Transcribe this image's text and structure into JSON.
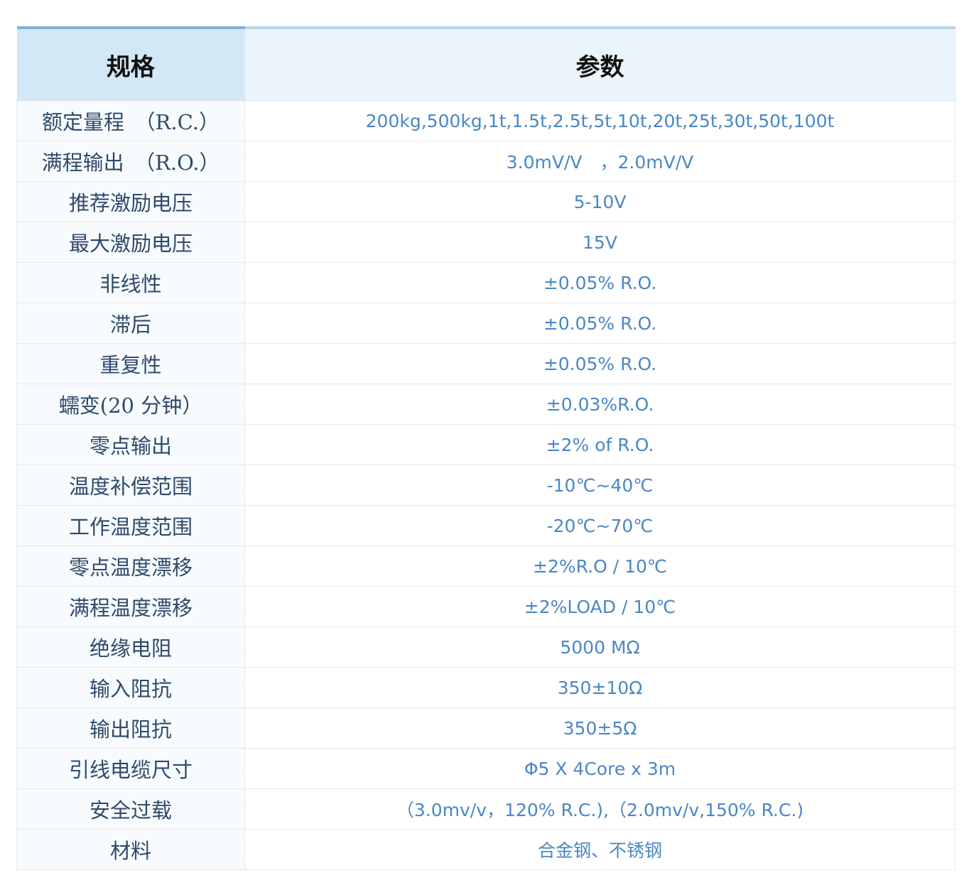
{
  "table": {
    "headers": [
      "规格",
      "参数"
    ],
    "rows": [
      {
        "spec": "额定量程　（R.C.）",
        "value": "200kg,500kg,1t,1.5t,2.5t,5t,10t,20t,25t,30t,50t,100t"
      },
      {
        "spec": "满程输出　（R.O.）",
        "value": "3.0mV/V　，2.0mV/V"
      },
      {
        "spec": "推荐激励电压",
        "value": "5-10V"
      },
      {
        "spec": "最大激励电压",
        "value": "15V"
      },
      {
        "spec": "非线性",
        "value": "±0.05% R.O."
      },
      {
        "spec": "滞后",
        "value": "±0.05% R.O."
      },
      {
        "spec": "重复性",
        "value": "±0.05% R.O."
      },
      {
        "spec": "蠕变(20 分钟）",
        "value": "±0.03%R.O."
      },
      {
        "spec": "零点输出",
        "value": "±2% of R.O."
      },
      {
        "spec": "温度补偿范围",
        "value": "-10℃~40℃"
      },
      {
        "spec": "工作温度范围",
        "value": "-20℃~70℃"
      },
      {
        "spec": "零点温度漂移",
        "value": "±2%R.O / 10℃"
      },
      {
        "spec": "满程温度漂移",
        "value": "±2%LOAD / 10℃"
      },
      {
        "spec": "绝缘电阻",
        "value": "5000 MΩ"
      },
      {
        "spec": "输入阻抗",
        "value": "350±10Ω"
      },
      {
        "spec": "输出阻抗",
        "value": "350±5Ω"
      },
      {
        "spec": "引线电缆尺寸",
        "value": "Φ5 X 4Core x 3m"
      },
      {
        "spec": "安全过载",
        "value": "（3.0mv/v，120% R.C.),（2.0mv/v,150% R.C.)"
      },
      {
        "spec": "材料",
        "value": "合金钢、不锈钢"
      }
    ]
  }
}
